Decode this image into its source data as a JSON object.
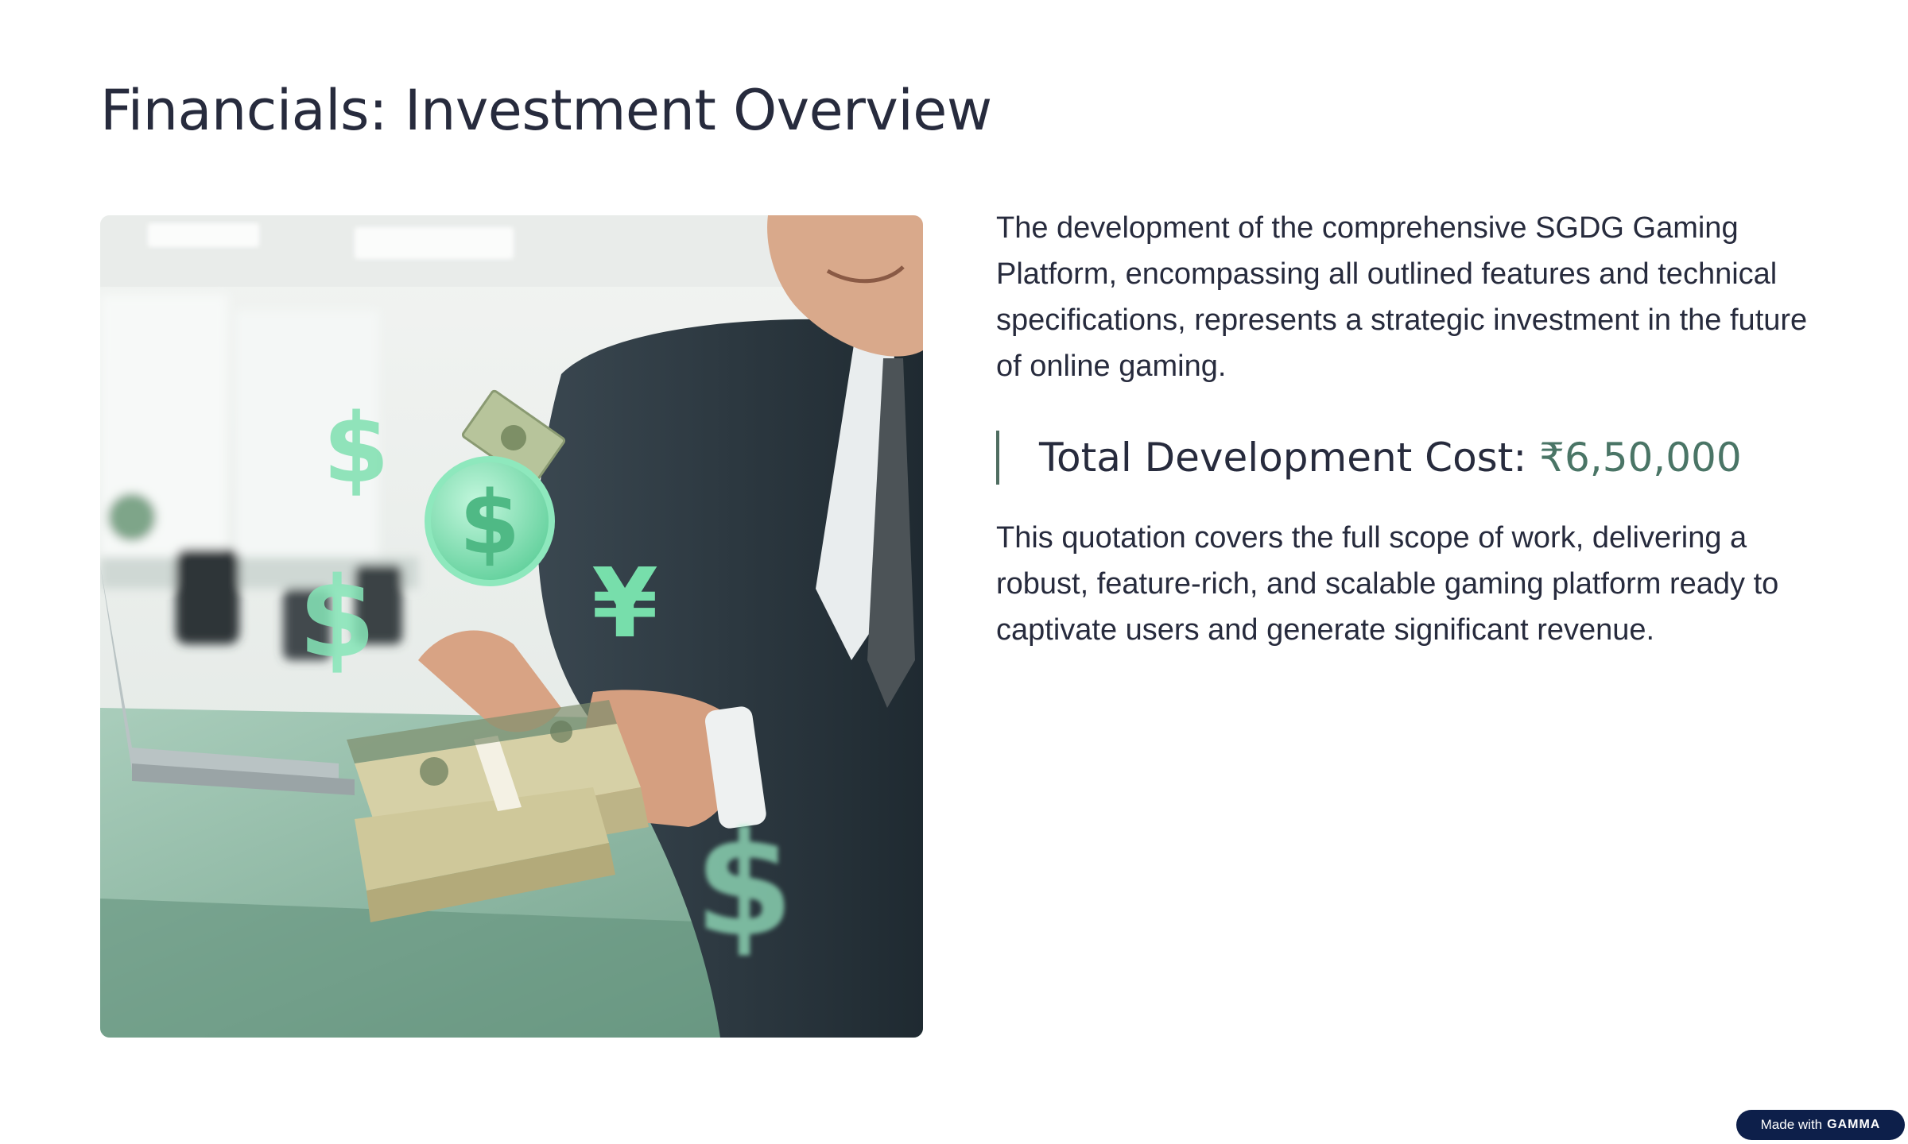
{
  "slide": {
    "title": "Financials: Investment Overview",
    "intro": "The development of the comprehensive SGDG Gaming Platform, encompassing all outlined features and technical specifications, represents a strategic investment in the future of online gaming.",
    "cost": {
      "label": "Total Development Cost:",
      "value": "₹6,50,000"
    },
    "closing": "This quotation covers the full scope of work, delivering a robust, feature-rich, and scalable gaming platform ready to captivate users and generate significant revenue."
  },
  "badge": {
    "prefix": "Made with",
    "brand": "GAMMA"
  },
  "illustration": {
    "currency_symbols": [
      "$",
      "$",
      "$",
      "¥",
      "$"
    ]
  },
  "colors": {
    "title": "#272b3d",
    "accent": "#4a7566",
    "accent_bar": "#4f6d61",
    "badge_bg": "#0d1f4a",
    "coin_green": "#7fe0b0"
  }
}
